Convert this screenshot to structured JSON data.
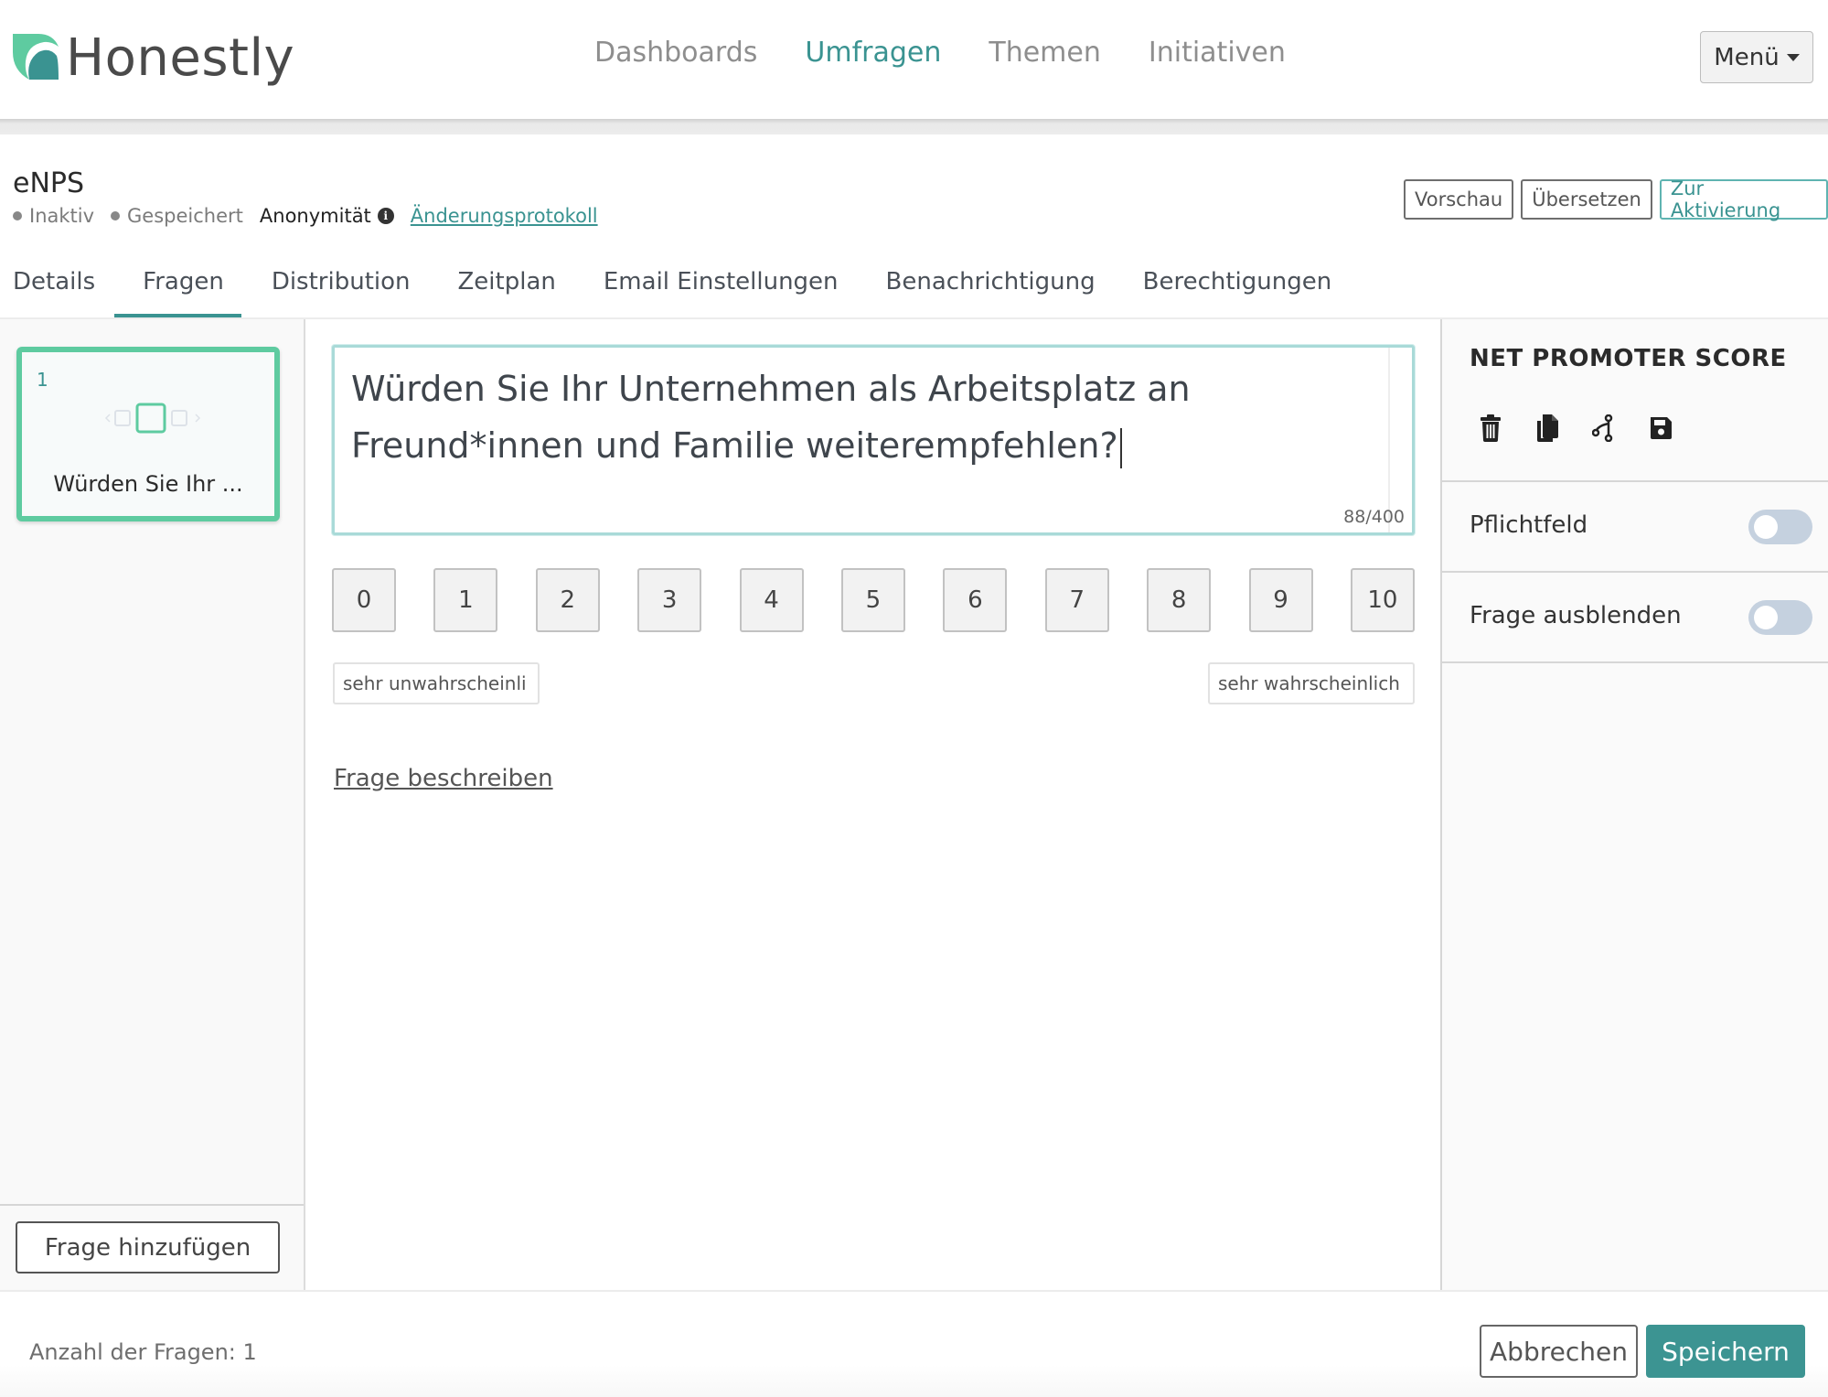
{
  "brand": {
    "name": "Honestly",
    "accent": "#3a9391",
    "accent_light": "#5ecba0"
  },
  "nav": {
    "items": [
      {
        "label": "Dashboards",
        "active": false
      },
      {
        "label": "Umfragen",
        "active": true
      },
      {
        "label": "Themen",
        "active": false
      },
      {
        "label": "Initiativen",
        "active": false
      }
    ],
    "menu_label": "Menü"
  },
  "survey": {
    "title": "eNPS",
    "status": [
      "Inaktiv",
      "Gespeichert"
    ],
    "anonymity_label": "Anonymität",
    "changelog_label": "Änderungsprotokoll",
    "actions": {
      "preview": "Vorschau",
      "translate": "Übersetzen",
      "activate": "Zur Aktivierung"
    }
  },
  "tabs": [
    {
      "label": "Details",
      "active": false
    },
    {
      "label": "Fragen",
      "active": true
    },
    {
      "label": "Distribution",
      "active": false
    },
    {
      "label": "Zeitplan",
      "active": false
    },
    {
      "label": "Email Einstellungen",
      "active": false
    },
    {
      "label": "Benachrichtigung",
      "active": false
    },
    {
      "label": "Berechtigungen",
      "active": false
    }
  ],
  "question_list": {
    "items": [
      {
        "number": "1",
        "label": "Würden Sie Ihr ...",
        "selected": true
      }
    ],
    "add_button": "Frage hinzufügen"
  },
  "editor": {
    "question_text": "Würden Sie Ihr Unternehmen als Arbeitsplatz an Freund*innen und Familie weiterempfehlen?",
    "char_count": "88/400",
    "scale": [
      "0",
      "1",
      "2",
      "3",
      "4",
      "5",
      "6",
      "7",
      "8",
      "9",
      "10"
    ],
    "low_label": "sehr unwahrscheinli",
    "high_label": "sehr wahrscheinlich",
    "describe_link": "Frage beschreiben"
  },
  "settings_panel": {
    "title": "NET PROMOTER SCORE",
    "icons": [
      "trash-icon",
      "copy-icon",
      "branch-icon",
      "save-icon"
    ],
    "toggles": [
      {
        "label": "Pflichtfeld",
        "on": false
      },
      {
        "label": "Frage ausblenden",
        "on": false
      }
    ]
  },
  "footer": {
    "question_count": "Anzahl der Fragen: 1",
    "cancel": "Abbrechen",
    "save": "Speichern"
  }
}
